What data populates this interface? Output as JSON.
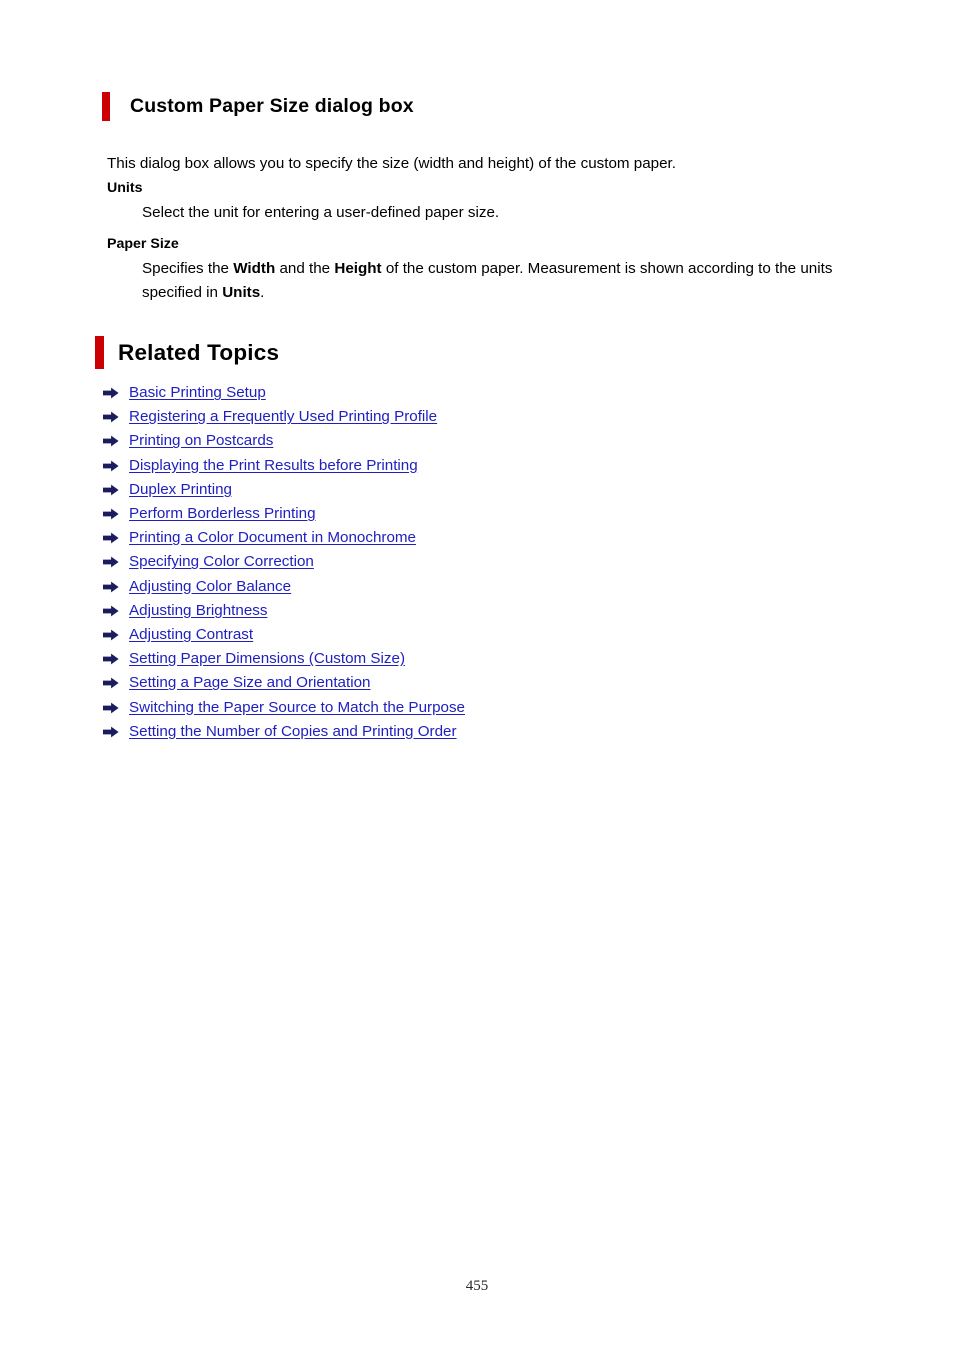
{
  "document": {
    "page_number": "455",
    "accent_color": "#cc0000",
    "link_color": "#2020c0"
  },
  "section_main": {
    "heading": "Custom Paper Size dialog box",
    "intro": "This dialog box allows you to specify the size (width and height) of the custom paper.",
    "definitions": [
      {
        "term": "Units",
        "description": "Select the unit for entering a user-defined paper size."
      },
      {
        "term": "Paper Size",
        "description_parts": {
          "p1": "Specifies the ",
          "b1": "Width",
          "p2": " and the ",
          "b2": "Height",
          "p3": " of the custom paper. Measurement is shown according to the units specified in ",
          "b3": "Units",
          "p4": "."
        }
      }
    ]
  },
  "section_related": {
    "heading": "Related Topics",
    "bullet_icon": "arrow-right-icon",
    "links": [
      {
        "label": "Basic Printing Setup"
      },
      {
        "label": "Registering a Frequently Used Printing Profile"
      },
      {
        "label": "Printing on Postcards"
      },
      {
        "label": "Displaying the Print Results before Printing"
      },
      {
        "label": "Duplex Printing"
      },
      {
        "label": "Perform Borderless Printing"
      },
      {
        "label": "Printing a Color Document in Monochrome"
      },
      {
        "label": "Specifying Color Correction"
      },
      {
        "label": "Adjusting Color Balance"
      },
      {
        "label": "Adjusting Brightness"
      },
      {
        "label": "Adjusting Contrast"
      },
      {
        "label": "Setting Paper Dimensions (Custom Size)"
      },
      {
        "label": "Setting a Page Size and Orientation"
      },
      {
        "label": "Switching the Paper Source to Match the Purpose"
      },
      {
        "label": "Setting the Number of Copies and Printing Order"
      }
    ]
  }
}
